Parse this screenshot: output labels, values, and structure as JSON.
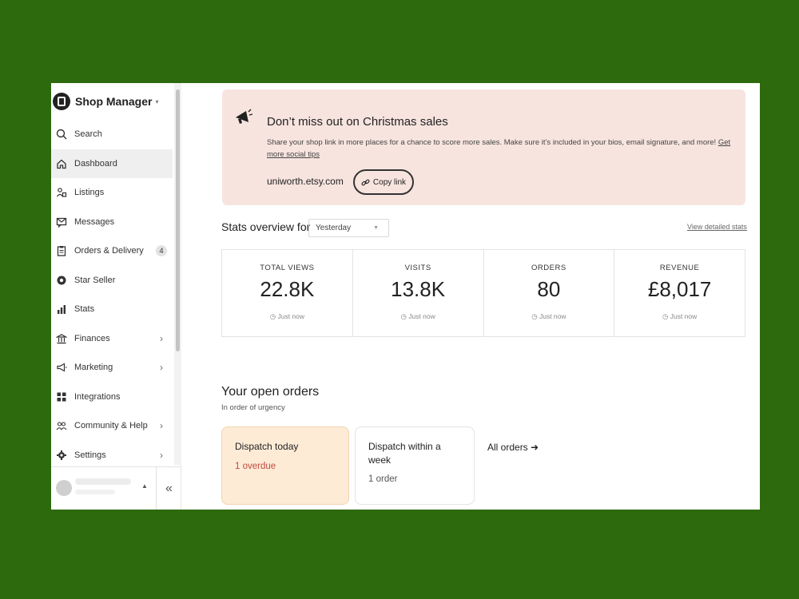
{
  "sidebar": {
    "title": "Shop Manager",
    "caret": "▾",
    "items": [
      {
        "label": "Search",
        "icon": "search-icon"
      },
      {
        "label": "Dashboard",
        "icon": "home-icon"
      },
      {
        "label": "Listings",
        "icon": "listings-icon"
      },
      {
        "label": "Messages",
        "icon": "messages-icon"
      },
      {
        "label": "Orders & Delivery",
        "icon": "clipboard-icon",
        "badge": "4"
      },
      {
        "label": "Star Seller",
        "icon": "star-seller-icon"
      },
      {
        "label": "Stats",
        "icon": "stats-icon"
      },
      {
        "label": "Finances",
        "icon": "bank-icon"
      },
      {
        "label": "Marketing",
        "icon": "megaphone-icon"
      },
      {
        "label": "Integrations",
        "icon": "grid-icon"
      },
      {
        "label": "Community & Help",
        "icon": "community-icon"
      },
      {
        "label": "Settings",
        "icon": "gear-icon"
      }
    ],
    "collapse_glyph": "«"
  },
  "banner": {
    "title": "Don’t miss out on Christmas sales",
    "text": "Share your shop link in more places for a chance to score more sales. Make sure it’s included in your bios, email signature, and more!",
    "link_text": "Get more social tips",
    "shop_url": "uniworth.etsy.com",
    "copy_label": "Copy link"
  },
  "stats": {
    "title": "Stats overview for",
    "period": "Yesterday",
    "detailed_link": "View detailed stats",
    "cards": [
      {
        "label": "TOTAL VIEWS",
        "value": "22.8K",
        "time": "Just now"
      },
      {
        "label": "VISITS",
        "value": "13.8K",
        "time": "Just now"
      },
      {
        "label": "ORDERS",
        "value": "80",
        "time": "Just now"
      },
      {
        "label": "REVENUE",
        "value": "£8,017",
        "time": "Just now"
      }
    ]
  },
  "orders": {
    "title": "Your open orders",
    "subtitle": "In order of urgency",
    "cards": [
      {
        "title": "Dispatch today",
        "sub": "1 overdue"
      },
      {
        "title": "Dispatch within a week",
        "sub": "1 order"
      }
    ],
    "all_orders": "All orders ➜"
  },
  "colors": {
    "background": "#2d6a0e",
    "banner": "#f7e4df",
    "urgent_card": "#fdebd6",
    "overdue_text": "#c14a3f"
  }
}
